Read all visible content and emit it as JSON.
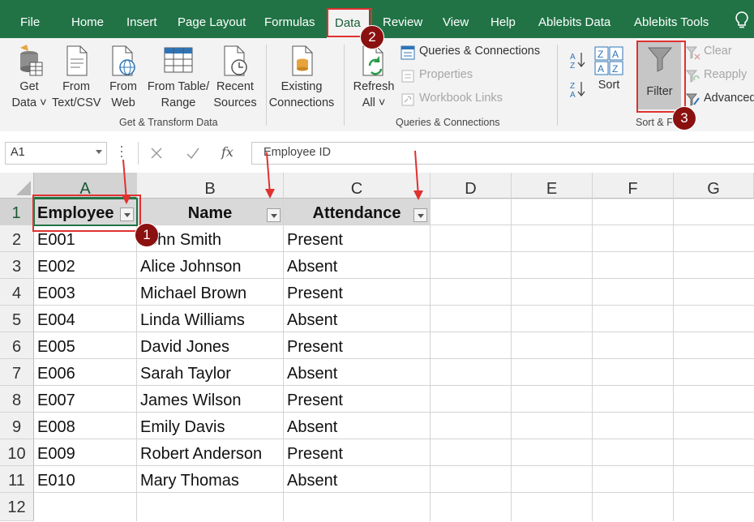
{
  "menu": {
    "tabs": [
      "File",
      "Home",
      "Insert",
      "Page Layout",
      "Formulas",
      "Data",
      "Review",
      "View",
      "Help",
      "Ablebits Data",
      "Ablebits Tools"
    ],
    "active": "Data"
  },
  "ribbon": {
    "get_transform": {
      "buttons": [
        {
          "line1": "Get",
          "line2": "Data ˅",
          "icon": "database-icon"
        },
        {
          "line1": "From",
          "line2": "Text/CSV",
          "icon": "text-file-icon"
        },
        {
          "line1": "From",
          "line2": "Web",
          "icon": "web-icon"
        },
        {
          "line1": "From Table/",
          "line2": "Range",
          "icon": "table-icon"
        },
        {
          "line1": "Recent",
          "line2": "Sources",
          "icon": "recent-sources-icon"
        },
        {
          "line1": "Existing",
          "line2": "Connections",
          "icon": "existing-connections-icon"
        }
      ],
      "label": "Get & Transform Data"
    },
    "queries": {
      "refresh_line1": "Refresh",
      "refresh_line2": "All ˅",
      "items": [
        "Queries & Connections",
        "Properties",
        "Workbook Links"
      ],
      "label": "Queries & Connections"
    },
    "sort_filter": {
      "sort": "Sort",
      "filter": "Filter",
      "clear": "Clear",
      "reapply": "Reapply",
      "advanced": "Advanced",
      "label": "Sort & F"
    }
  },
  "formula_bar": {
    "name_box": "A1",
    "fx": "fx",
    "value": "Employee ID"
  },
  "grid": {
    "columns": [
      "A",
      "B",
      "C",
      "D",
      "E",
      "F",
      "G"
    ],
    "rows": [
      "1",
      "2",
      "3",
      "4",
      "5",
      "6",
      "7",
      "8",
      "9",
      "10",
      "11",
      "12"
    ],
    "headers": [
      "Employee",
      "Name",
      "Attendance"
    ],
    "data": [
      [
        "E001",
        "John Smith",
        "Present"
      ],
      [
        "E002",
        "Alice Johnson",
        "Absent"
      ],
      [
        "E003",
        "Michael Brown",
        "Present"
      ],
      [
        "E004",
        "Linda Williams",
        "Absent"
      ],
      [
        "E005",
        "David Jones",
        "Present"
      ],
      [
        "E006",
        "Sarah Taylor",
        "Absent"
      ],
      [
        "E007",
        "James Wilson",
        "Present"
      ],
      [
        "E008",
        "Emily Davis",
        "Absent"
      ],
      [
        "E009",
        "Robert Anderson",
        "Present"
      ],
      [
        "E010",
        "Mary Thomas",
        "Absent"
      ]
    ]
  },
  "annotations": {
    "badges": [
      "1",
      "2",
      "3"
    ]
  },
  "colors": {
    "excel_green": "#217346",
    "annotation_red": "#e03131",
    "badge_dark_red": "#8b1010"
  }
}
